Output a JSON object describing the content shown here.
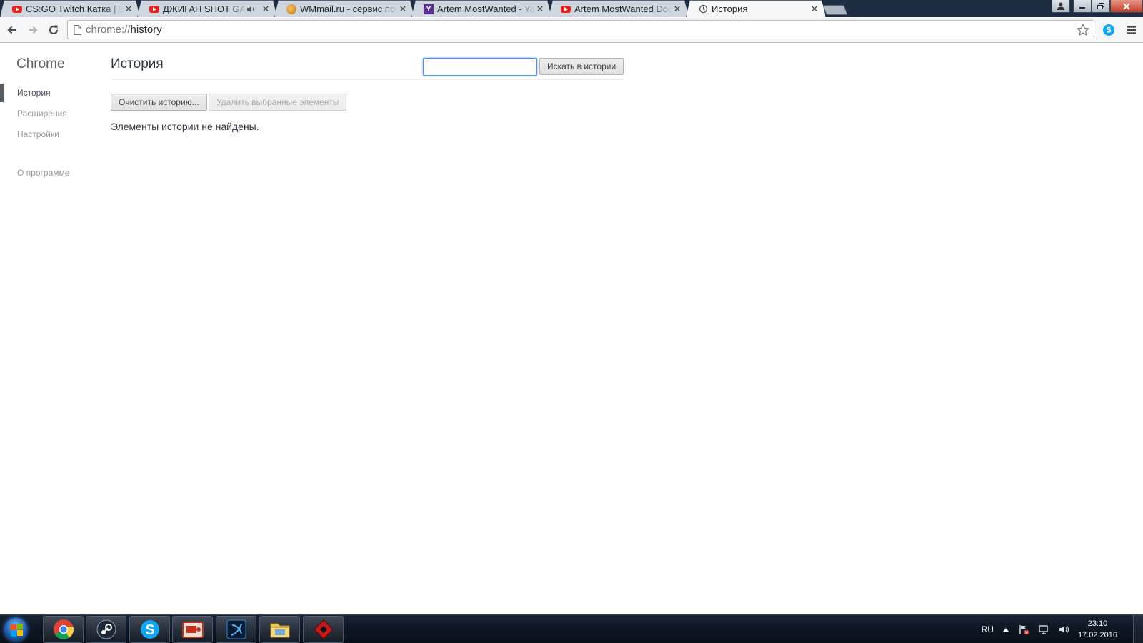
{
  "browser": {
    "tabs": [
      {
        "title": "CS:GO Twitch Катка | Затормозили",
        "icon": "youtube-favicon",
        "audio": false
      },
      {
        "title": "ДЖИГАН SHOT GAME",
        "icon": "youtube-favicon",
        "audio": true
      },
      {
        "title": "WMmail.ru - сервис почтовых рассылок",
        "icon": "wmmail-favicon",
        "audio": false
      },
      {
        "title": "Artem MostWanted - Yahoo",
        "icon": "yahoo-favicon",
        "audio": false
      },
      {
        "title": "Artem MostWanted Dodge",
        "icon": "youtube-favicon",
        "audio": false
      },
      {
        "title": "История",
        "icon": "history-favicon",
        "audio": false,
        "active": true
      }
    ],
    "address": {
      "scheme": "chrome://",
      "host": "history"
    }
  },
  "sidebar": {
    "brand": "Chrome",
    "items": [
      {
        "label": "История",
        "selected": true
      },
      {
        "label": "Расширения",
        "selected": false
      },
      {
        "label": "Настройки",
        "selected": false
      }
    ],
    "about": "О программе"
  },
  "main": {
    "title": "История",
    "search": {
      "value": "",
      "button": "Искать в истории"
    },
    "clear_button": "Очистить историю...",
    "remove_button": "Удалить выбранные элементы",
    "empty_message": "Элементы истории не найдены."
  },
  "taskbar": {
    "apps": [
      "chrome-icon",
      "steam-icon",
      "skype-icon",
      "video-app-icon",
      "battlenet-icon",
      "file-explorer-icon",
      "game-launcher-icon"
    ],
    "language": "RU",
    "time": "23:10",
    "date": "17.02.2016"
  },
  "colors": {
    "accent": "#4d90fe",
    "sidebar_selected": "#5a5f66",
    "taskbar": "#0f1826"
  }
}
